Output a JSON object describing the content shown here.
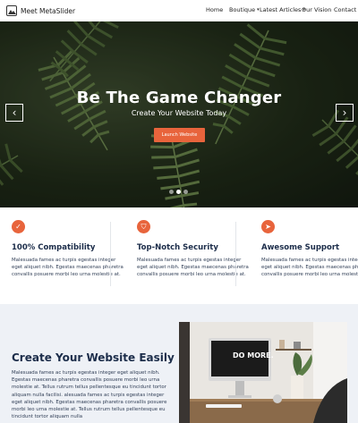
{
  "header": {
    "logo_text": "Meet MetaSlider",
    "nav": [
      {
        "label": "Home",
        "has_caret": false
      },
      {
        "label": "Boutique",
        "has_caret": true
      },
      {
        "label": "Latest Articles",
        "has_caret": true
      },
      {
        "label": "Our Vision",
        "has_caret": false
      },
      {
        "label": "Contact",
        "has_caret": false
      }
    ]
  },
  "hero": {
    "title": "Be The Game Changer",
    "subtitle": "Create Your Website Today",
    "button_label": "Launch Website",
    "prev_arrow": "‹",
    "next_arrow": "›",
    "slide_count": 3,
    "active_slide": 2
  },
  "features": [
    {
      "icon": "check-icon",
      "icon_glyph": "✓",
      "title": "100% Compatibility",
      "text": "Malesuada fames ac turpis egestas integer eget aliquet nibh. Egestas maecenas pharetra convallis posuere morbi leo urna molestie at."
    },
    {
      "icon": "shield-icon",
      "icon_glyph": "⛉",
      "title": "Top-Notch Security",
      "text": "Malesuada fames ac turpis egestas integer eget aliquet nibh. Egestas maecenas pharetra convallis posuere morbi leo urna molestie at."
    },
    {
      "icon": "paper-plane-icon",
      "icon_glyph": "➤",
      "title": "Awesome Support",
      "text": "Malesuada fames ac turpis egestas integer eget aliquet nibh. Egestas maecenas pharetra convallis posuere morbi leo urna molestie at."
    }
  ],
  "section": {
    "title": "Create Your Website Easily",
    "text": "Malesuada fames ac turpis egestas integer eget aliquet nibh. Egestas maecenas pharetra convallis posuere morbi leo urna molestie at. Tellus rutrum tellus pellentesque eu tincidunt tortor aliquam nulla facilisi. alesuada fames ac turpis egestas integer eget aliquet nibh. Egestas maecenas pharetra convallis posuere morbi leo urna molestie at. Tellus rutrum tellus pellentesque eu tincidunt tortor aliquam nulla",
    "photo_caption": "DO MORE."
  },
  "colors": {
    "accent": "#e8643c",
    "heading": "#1c2d4a",
    "section_bg": "#eef1f6"
  }
}
